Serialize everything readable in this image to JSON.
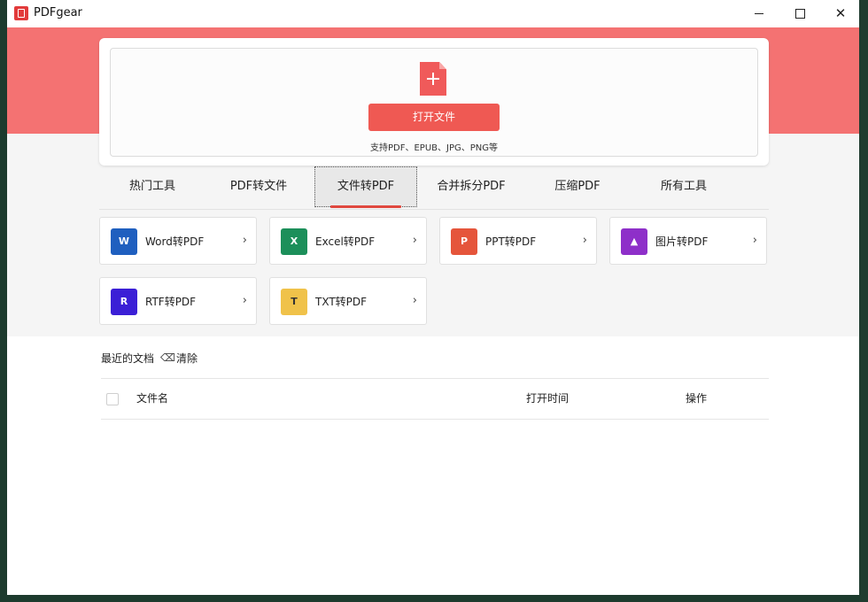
{
  "window": {
    "title": "PDFgear",
    "controls": {
      "minimize": "minimize-icon",
      "maximize": "maximize-icon",
      "close": "close-icon"
    }
  },
  "upload": {
    "open_button": "打开文件",
    "support_text": "支持PDF、EPUB、JPG、PNG等"
  },
  "tabs": [
    {
      "label": "热门工具"
    },
    {
      "label": "PDF转文件"
    },
    {
      "label": "文件转PDF",
      "active": true
    },
    {
      "label": "合并拆分PDF"
    },
    {
      "label": "压缩PDF"
    },
    {
      "label": "所有工具"
    }
  ],
  "tools": [
    {
      "label": "Word转PDF",
      "icon": "word-icon",
      "color": "#1f5fbf",
      "letter": "W"
    },
    {
      "label": "Excel转PDF",
      "icon": "excel-icon",
      "color": "#1c8f5a",
      "letter": "X"
    },
    {
      "label": "PPT转PDF",
      "icon": "ppt-icon",
      "color": "#e5553b",
      "letter": "P"
    },
    {
      "label": "图片转PDF",
      "icon": "image-icon",
      "color": "#8e2fc9",
      "letter": "▲"
    },
    {
      "label": "RTF转PDF",
      "icon": "rtf-icon",
      "color": "#3b1fd6",
      "letter": "R"
    },
    {
      "label": "TXT转PDF",
      "icon": "txt-icon",
      "color": "#f0c24a",
      "letter": "T"
    }
  ],
  "recent": {
    "title": "最近的文档",
    "clear_label": "清除",
    "columns": {
      "name": "文件名",
      "opened": "打开时间",
      "actions": "操作"
    }
  },
  "colors": {
    "accent": "#ef5953",
    "hero": "#f47272"
  }
}
